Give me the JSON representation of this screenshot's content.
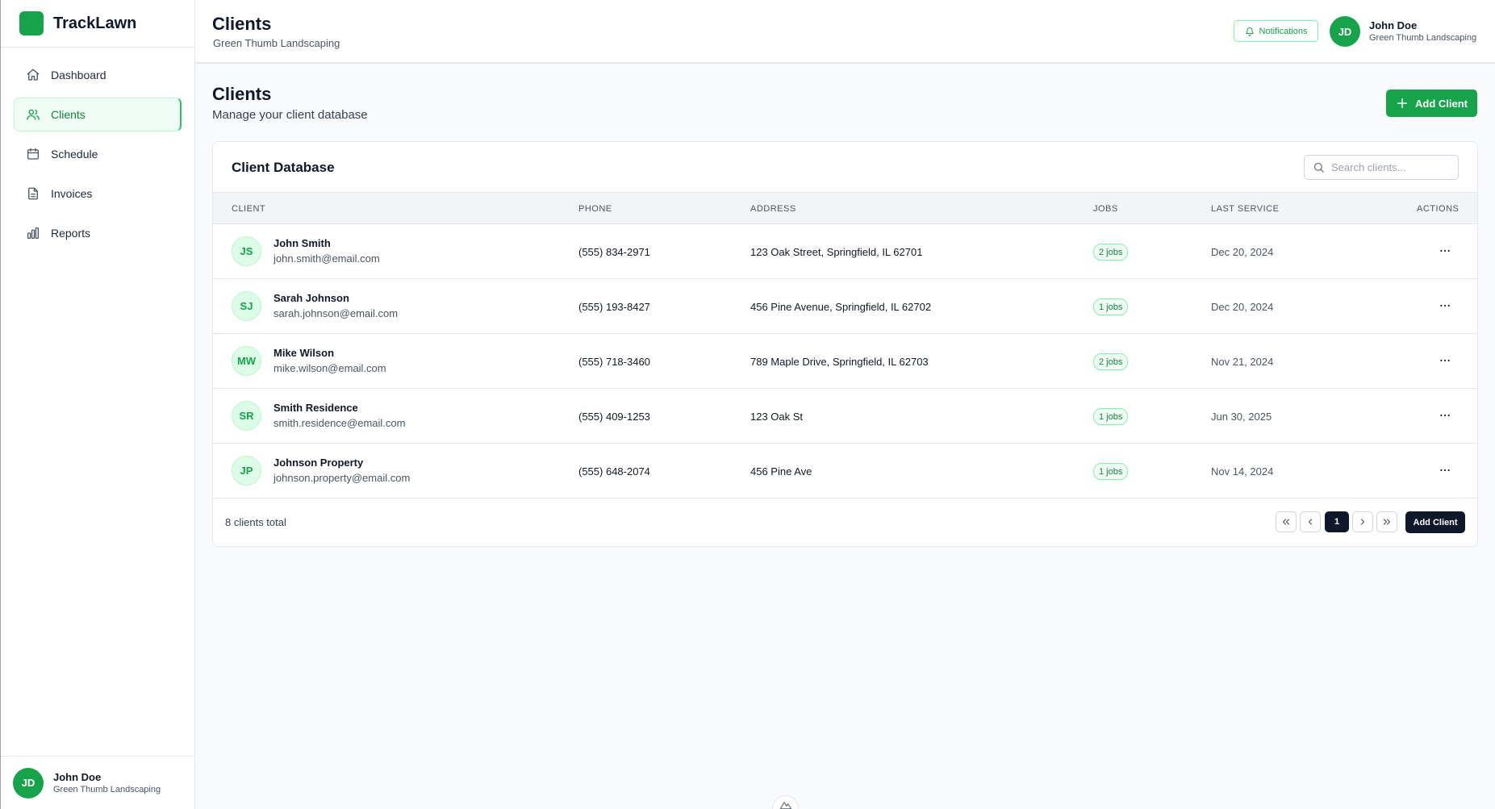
{
  "app": {
    "name": "TrackLawn"
  },
  "sidebar": {
    "items": [
      {
        "label": "Dashboard",
        "icon": "home-icon"
      },
      {
        "label": "Clients",
        "icon": "users-icon",
        "active": true
      },
      {
        "label": "Schedule",
        "icon": "calendar-icon"
      },
      {
        "label": "Invoices",
        "icon": "file-icon"
      },
      {
        "label": "Reports",
        "icon": "bar-chart-icon"
      }
    ],
    "user": {
      "initials": "JD",
      "name": "John Doe",
      "org": "Green Thumb Landscaping"
    }
  },
  "header": {
    "title": "Clients",
    "subtitle": "Green Thumb Landscaping",
    "notifications_label": "Notifications",
    "user": {
      "initials": "JD",
      "name": "John Doe",
      "org": "Green Thumb Landscaping"
    }
  },
  "page": {
    "title": "Clients",
    "subtitle": "Manage your client database",
    "add_button_label": "Add Client"
  },
  "card": {
    "title": "Client Database",
    "search_placeholder": "Search clients...",
    "columns": [
      "CLIENT",
      "PHONE",
      "ADDRESS",
      "JOBS",
      "LAST SERVICE",
      "ACTIONS"
    ],
    "rows": [
      {
        "initials": "JS",
        "name": "John Smith",
        "email": "john.smith@email.com",
        "phone": "(555) 834-2971",
        "address": "123 Oak Street, Springfield, IL 62701",
        "jobs": "2 jobs",
        "last_service": "Dec 20, 2024"
      },
      {
        "initials": "SJ",
        "name": "Sarah Johnson",
        "email": "sarah.johnson@email.com",
        "phone": "(555) 193-8427",
        "address": "456 Pine Avenue, Springfield, IL 62702",
        "jobs": "1 jobs",
        "last_service": "Dec 20, 2024"
      },
      {
        "initials": "MW",
        "name": "Mike Wilson",
        "email": "mike.wilson@email.com",
        "phone": "(555) 718-3460",
        "address": "789 Maple Drive, Springfield, IL 62703",
        "jobs": "2 jobs",
        "last_service": "Nov 21, 2024"
      },
      {
        "initials": "SR",
        "name": "Smith Residence",
        "email": "smith.residence@email.com",
        "phone": "(555) 409-1253",
        "address": "123 Oak St",
        "jobs": "1 jobs",
        "last_service": "Jun 30, 2025"
      },
      {
        "initials": "JP",
        "name": "Johnson Property",
        "email": "johnson.property@email.com",
        "phone": "(555) 648-2074",
        "address": "456 Pine Ave",
        "jobs": "1 jobs",
        "last_service": "Nov 14, 2024"
      }
    ],
    "footer": {
      "total_text": "8 clients total",
      "current_page": "1",
      "add_button_label": "Add Client"
    }
  },
  "colors": {
    "accent": "#16a34a",
    "dark": "#0f172a"
  }
}
